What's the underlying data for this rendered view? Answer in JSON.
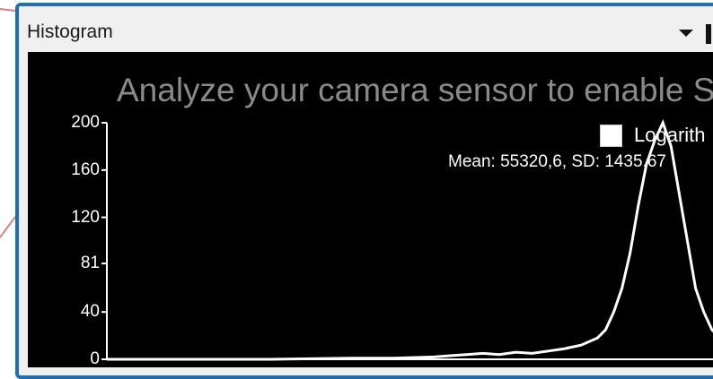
{
  "window": {
    "title": "Histogram"
  },
  "plot": {
    "banner": "Analyze your camera sensor to enable S",
    "logarithmic_label": "Logarith",
    "stats": "Mean: 55320,6, SD: 1435,67"
  },
  "chart_data": {
    "type": "line",
    "title": "",
    "xlabel": "",
    "ylabel": "",
    "y_ticks": [
      "0",
      "40",
      "81",
      "120",
      "160",
      "200"
    ],
    "y_tick_values": [
      0,
      40,
      81,
      120,
      160,
      200
    ],
    "ylim": [
      0,
      200
    ],
    "grid": false,
    "series": [
      {
        "color": "#ffffff",
        "x": [
          0,
          100,
          200,
          300,
          350,
          400,
          420,
          440,
          460,
          480,
          500,
          520,
          540,
          560,
          580,
          600,
          610,
          620,
          630,
          640,
          650,
          660,
          670,
          680,
          690,
          700,
          710,
          720,
          730,
          740,
          750,
          760
        ],
        "values": [
          0,
          0,
          0,
          1,
          1,
          2,
          3,
          4,
          5,
          4,
          6,
          5,
          7,
          9,
          12,
          18,
          25,
          40,
          60,
          90,
          130,
          165,
          185,
          200,
          180,
          140,
          100,
          60,
          40,
          25,
          18,
          12
        ]
      }
    ]
  },
  "colors": {
    "window_border": "#1f6fb5",
    "plot_background": "#000000",
    "curve": "#ffffff",
    "banner_text": "#8a8a8a"
  }
}
